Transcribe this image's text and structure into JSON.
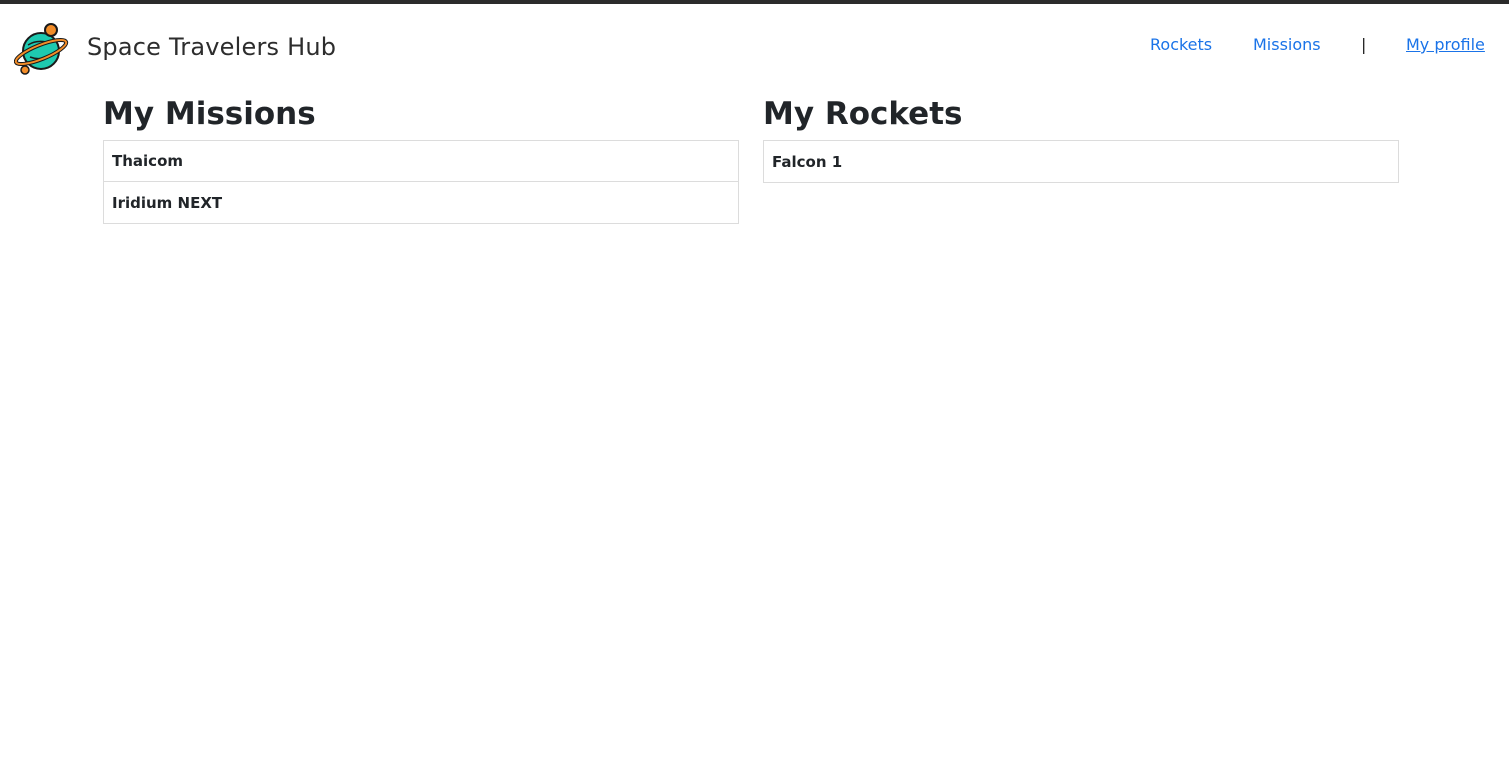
{
  "header": {
    "brand_title": "Space Travelers Hub",
    "logo_icon": "planet-icon",
    "nav": {
      "rockets": "Rockets",
      "missions": "Missions",
      "separator": "|",
      "profile": "My profile"
    }
  },
  "missions": {
    "title": "My Missions",
    "items": [
      "Thaicom",
      "Iridium NEXT"
    ]
  },
  "rockets": {
    "title": "My Rockets",
    "items": [
      "Falcon 1"
    ]
  },
  "colors": {
    "link": "#1a73e8",
    "planet": "#1ec9b0",
    "accent": "#f28c28",
    "border": "#dcdcdc"
  }
}
